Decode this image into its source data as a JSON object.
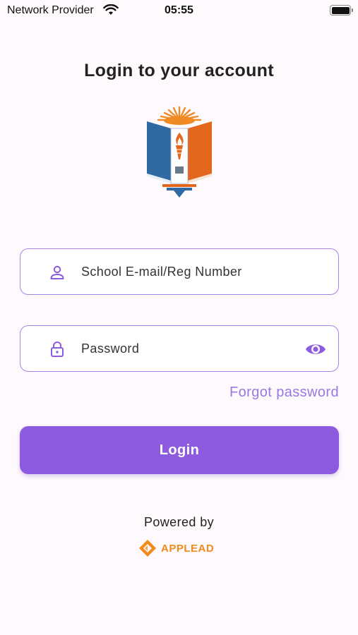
{
  "status_bar": {
    "carrier": "Network Provider",
    "time": "05:55",
    "wifi_icon": "wifi-icon",
    "battery_icon": "battery-icon"
  },
  "title": "Login to your account",
  "logo": {
    "icon": "school-crest-logo"
  },
  "email_field": {
    "placeholder": "School E-mail/Reg Number",
    "icon": "user-icon"
  },
  "password_field": {
    "placeholder": "Password",
    "icon": "lock-icon",
    "toggle_icon": "eye-icon"
  },
  "forgot_password": "Forgot password",
  "login_button": "Login",
  "footer": {
    "powered_by": "Powered by",
    "brand_name": "APPLEAD",
    "brand_icon": "applead-logo"
  },
  "colors": {
    "accent": "#8c5be0",
    "field_border": "#a784e6",
    "link": "#9a78df",
    "brand": "#f28a1c",
    "background": "#fdf9fd"
  }
}
